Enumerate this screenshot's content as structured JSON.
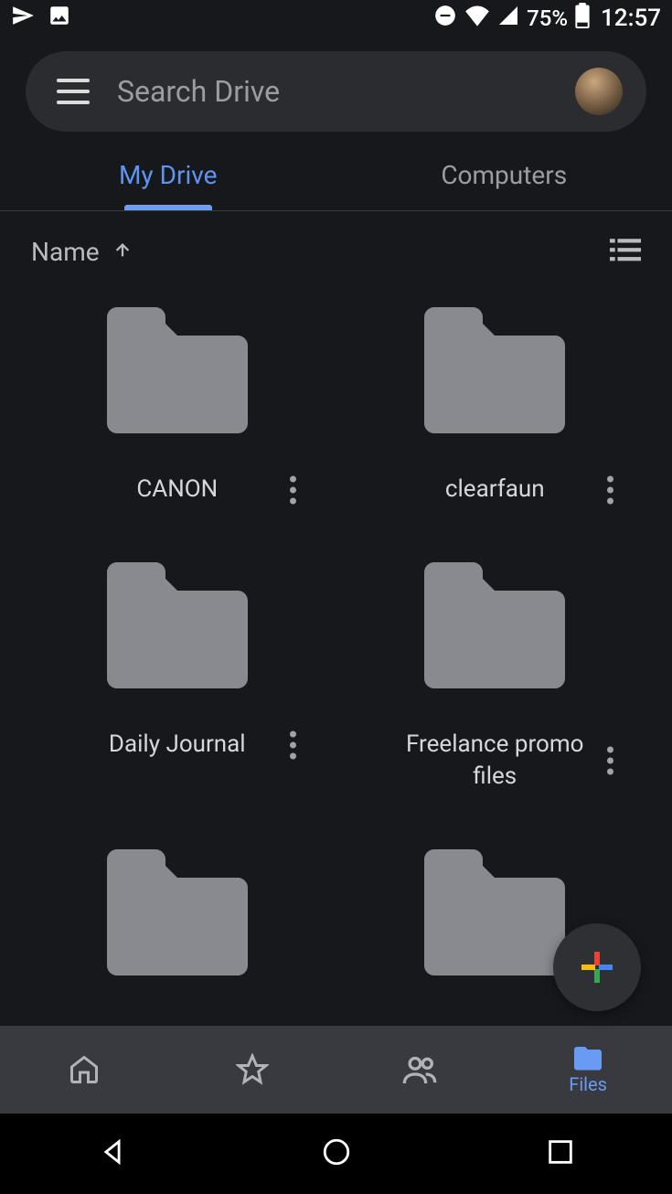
{
  "status": {
    "battery_pct": "75%",
    "time": "12:57"
  },
  "search": {
    "placeholder": "Search Drive"
  },
  "tabs": {
    "my_drive": "My Drive",
    "computers": "Computers"
  },
  "sort": {
    "label": "Name"
  },
  "folders": [
    {
      "name": "CANON"
    },
    {
      "name": "clearfaun"
    },
    {
      "name": "Daily Journal"
    },
    {
      "name": "Freelance promo files"
    },
    {
      "name": ""
    },
    {
      "name": ""
    }
  ],
  "bottom_nav": {
    "files_label": "Files"
  }
}
